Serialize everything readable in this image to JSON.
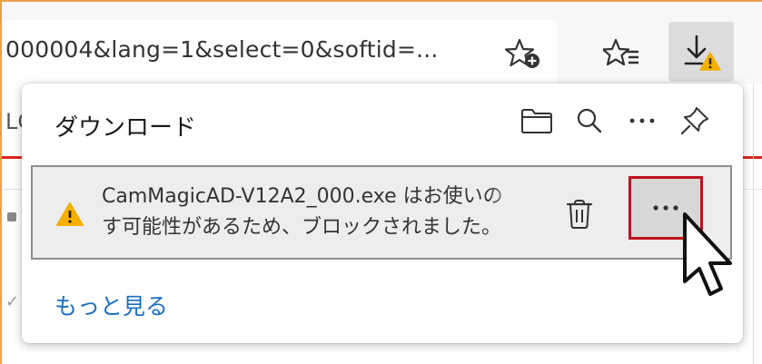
{
  "browser": {
    "address_text": "000004&lang=1&select=0&softid=...",
    "toolbar_icons": [
      "add-favorite-icon",
      "favorites-list-icon",
      "downloads-warning-icon"
    ]
  },
  "page_behind": {
    "tab_text_fragment": "LC"
  },
  "downloads_panel": {
    "title": "ダウンロード",
    "actions": [
      "open-folder-icon",
      "search-icon",
      "more-options-icon",
      "pin-icon"
    ],
    "item": {
      "line1": "CamMagicAD-V12A2_000.exe はお使いの",
      "line2": "す可能性があるため、ブロックされました。",
      "status_icon": "warning-icon"
    },
    "show_more_label": "もっと見る"
  },
  "colors": {
    "warning": "#f4b000",
    "highlight_border": "#c1121f",
    "link": "#1a6fc0",
    "accent_line": "#d9261c",
    "frame": "#e8a24a"
  }
}
